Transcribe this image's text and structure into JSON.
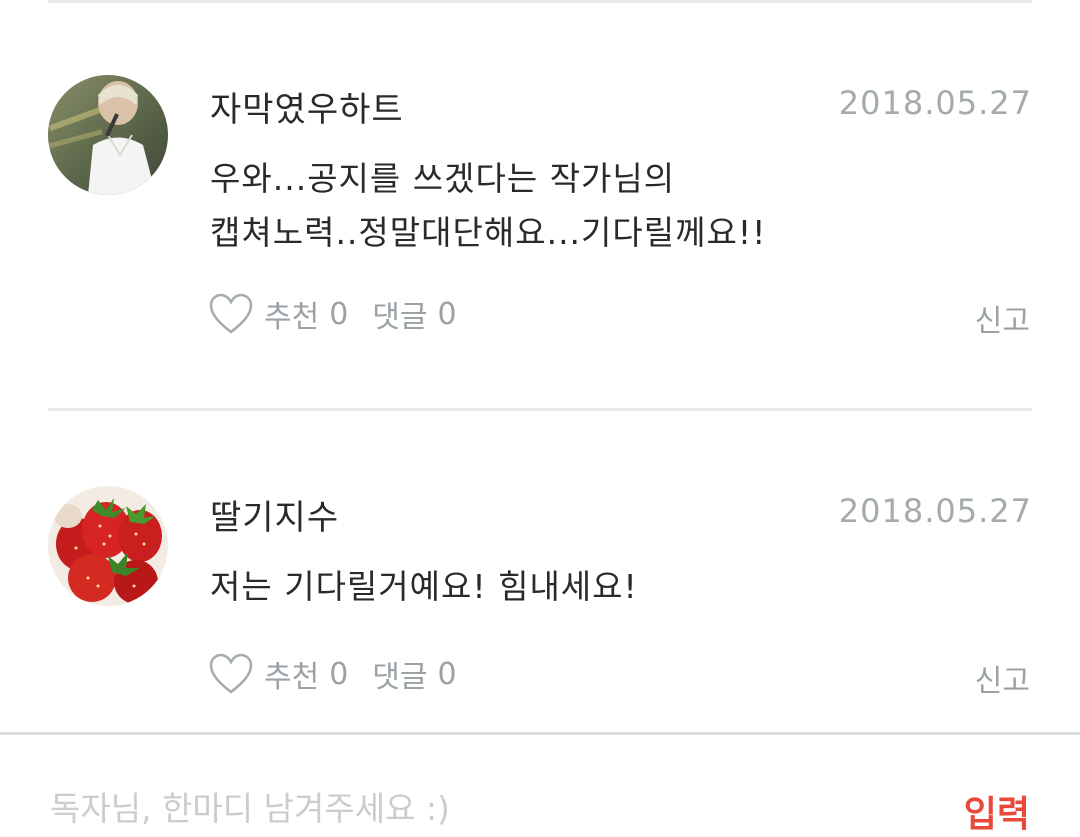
{
  "comments": [
    {
      "username": "자막였우하트",
      "date": "2018.05.27",
      "body_lines": [
        "우와...공지를 쓰겠다는 작가님의",
        "캡쳐노력..정말대단해요...기다릴께요!!"
      ],
      "like_label": "추천",
      "like_count": "0",
      "reply_label": "댓글",
      "reply_count": "0",
      "report_label": "신고",
      "avatar": "person-photo"
    },
    {
      "username": "딸기지수",
      "date": "2018.05.27",
      "body_lines": [
        "저는 기다릴거예요! 힘내세요!"
      ],
      "like_label": "추천",
      "like_count": "0",
      "reply_label": "댓글",
      "reply_count": "0",
      "report_label": "신고",
      "avatar": "strawberry-photo"
    }
  ],
  "input": {
    "placeholder": "독자님, 한마디 남겨주세요 :)",
    "submit_label": "입력"
  },
  "icons": {
    "like": "heart-outline-icon"
  },
  "colors": {
    "meta_gray": "#a4abae",
    "accent_red": "#e8493a",
    "divider": "#e8ecec"
  }
}
